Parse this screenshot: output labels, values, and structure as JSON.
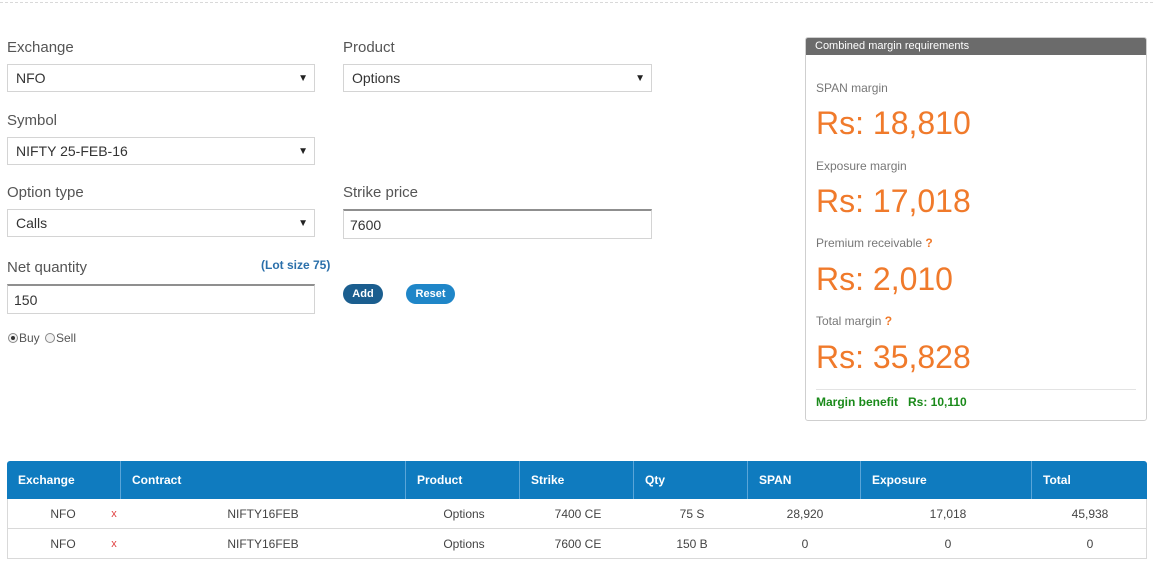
{
  "form": {
    "exchange_label": "Exchange",
    "exchange_value": "NFO",
    "product_label": "Product",
    "product_value": "Options",
    "symbol_label": "Symbol",
    "symbol_value": "NIFTY 25-FEB-16",
    "option_type_label": "Option type",
    "option_type_value": "Calls",
    "strike_label": "Strike price",
    "strike_value": "7600",
    "net_qty_label": "Net quantity",
    "lot_size": "(Lot size 75)",
    "net_qty_value": "150",
    "add_label": "Add",
    "reset_label": "Reset",
    "buy_label": "Buy",
    "sell_label": "Sell",
    "side_selected": "Buy"
  },
  "margins": {
    "title": "Combined margin requirements",
    "span_label": "SPAN margin",
    "span_value": "Rs: 18,810",
    "exposure_label": "Exposure margin",
    "exposure_value": "Rs: 17,018",
    "premium_label": "Premium receivable",
    "premium_value": "Rs: 2,010",
    "total_label": "Total margin",
    "total_value": "Rs: 35,828",
    "help_mark": "?",
    "benefit_label": "Margin benefit",
    "benefit_value": "Rs: 10,110"
  },
  "table": {
    "headers": [
      "Exchange",
      "Contract",
      "Product",
      "Strike",
      "Qty",
      "SPAN",
      "Exposure",
      "Total"
    ],
    "remove_mark": "x",
    "rows": [
      {
        "exchange": "NFO",
        "contract": "NIFTY16FEB",
        "product": "Options",
        "strike": "7400 CE",
        "qty": "75 S",
        "span": "28,920",
        "exposure": "17,018",
        "total": "45,938"
      },
      {
        "exchange": "NFO",
        "contract": "NIFTY16FEB",
        "product": "Options",
        "strike": "7600 CE",
        "qty": "150 B",
        "span": "0",
        "exposure": "0",
        "total": "0"
      }
    ]
  },
  "colors": {
    "accent_orange": "#f07a2b",
    "table_header_blue": "#0f7bbf",
    "benefit_green": "#1a8a1a",
    "add_button": "#1b5e8f",
    "reset_button": "#1f86c8"
  }
}
